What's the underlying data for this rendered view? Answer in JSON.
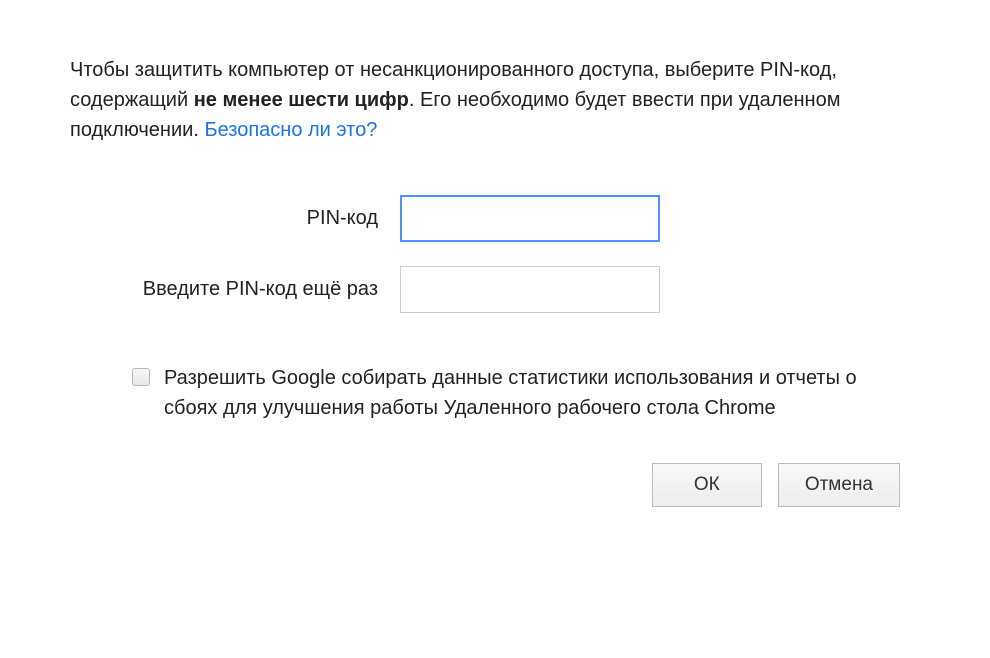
{
  "intro": {
    "text_before_bold": "Чтобы защитить компьютер от несанкционированного доступа, выберите PIN-код, содержащий ",
    "bold_text": "не менее шести цифр",
    "text_after_bold": ". Его необходимо будет ввести при удаленном подключении. ",
    "link_text": "Безопасно ли это?"
  },
  "form": {
    "pin_label": "PIN-код",
    "pin_value": "",
    "confirm_label": "Введите PIN-код ещё раз",
    "confirm_value": ""
  },
  "checkbox": {
    "label": "Разрешить Google собирать данные статистики использования и отчеты о сбоях для улучшения работы Удаленного рабочего стола Chrome",
    "checked": false
  },
  "buttons": {
    "ok": "ОК",
    "cancel": "Отмена"
  }
}
